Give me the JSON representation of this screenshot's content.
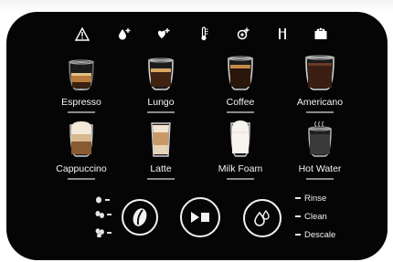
{
  "status_icons": [
    {
      "name": "warning-icon"
    },
    {
      "name": "water-refill-icon"
    },
    {
      "name": "bean-refill-icon"
    },
    {
      "name": "temperature-icon"
    },
    {
      "name": "cleaning-icon"
    },
    {
      "name": "milk-pipe-icon"
    },
    {
      "name": "grounds-container-icon"
    }
  ],
  "drinks": [
    {
      "label": "Espresso",
      "icon": "espresso-icon"
    },
    {
      "label": "Lungo",
      "icon": "lungo-icon"
    },
    {
      "label": "Coffee",
      "icon": "coffee-icon"
    },
    {
      "label": "Americano",
      "icon": "americano-icon"
    },
    {
      "label": "Cappuccino",
      "icon": "cappuccino-icon"
    },
    {
      "label": "Latte",
      "icon": "latte-icon"
    },
    {
      "label": "Milk Foam",
      "icon": "milk-foam-icon"
    },
    {
      "label": "Hot Water",
      "icon": "hot-water-icon"
    }
  ],
  "controls": {
    "strength_button": {
      "icon": "coffee-bean-icon",
      "levels": 3
    },
    "start_stop_button": {
      "icon": "play-stop-icon"
    },
    "maintenance_button": {
      "icon": "water-drops-icon"
    },
    "maintenance_options": [
      "Rinse",
      "Clean",
      "Descale"
    ]
  }
}
